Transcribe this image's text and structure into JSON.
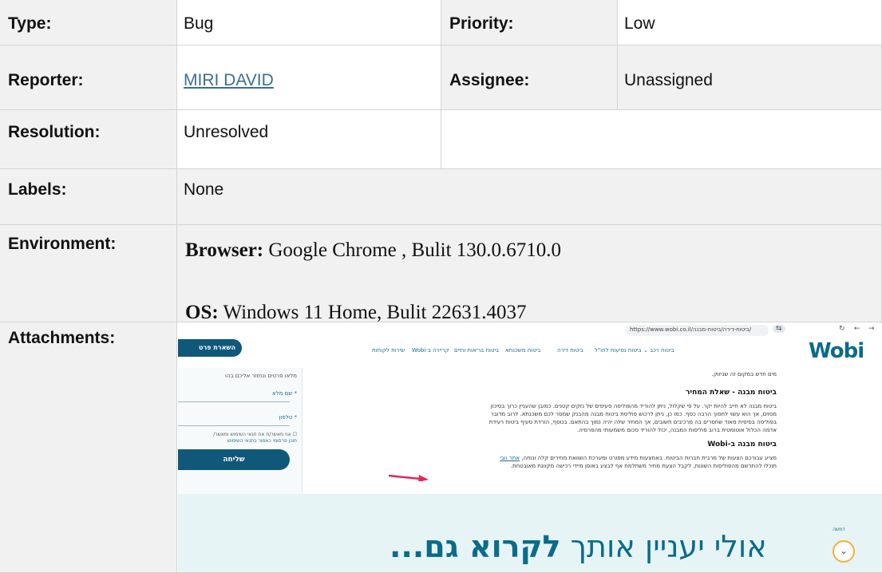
{
  "fields": {
    "type": {
      "label": "Type:",
      "value": "Bug"
    },
    "priority": {
      "label": "Priority:",
      "value": "Low"
    },
    "reporter": {
      "label": "Reporter:",
      "value": "MIRI DAVID"
    },
    "assignee": {
      "label": "Assignee:",
      "value": "Unassigned"
    },
    "resolution": {
      "label": "Resolution:",
      "value": "Unresolved"
    },
    "labels": {
      "label": "Labels:",
      "value": "None"
    },
    "environment": {
      "label": "Environment:",
      "browser_key": "Browser:",
      "browser_value": "Google Chrome , Bulit 130.0.6710.0",
      "os_key": "OS:",
      "os_value": "Windows 11 Home, Bulit 22631.4037"
    },
    "attachments": {
      "label": "Attachments:"
    }
  },
  "attachment": {
    "url": "https://www.wobi.co.il/ביטוח-דירה/ביטוח-מבנה/",
    "logo": "Wobi",
    "nav_items": [
      "ביטוח רכב ⌄",
      "ביטוח נסיעות לחו\"ל",
      "ביטוח דירה",
      "ביטוח משכנתא",
      "ביטוח בריאות וחיים",
      "קריירה ב-Wobi",
      "שירות לקוחות"
    ],
    "cta_top": "השארת פרט",
    "form_intro": "מלאו פרטים ונחזור אליכם בהו",
    "form_name": "* שם מלא",
    "form_phone": "* טלפון",
    "form_consent_1": "☐ אני מאשר/ת את תנאי השימוש ומאשר/",
    "form_consent_2": "תוכן פרסומי כאמור בתנאי השימוש",
    "send_button": "שליחה",
    "intro_line": "מים חדש במקום זה שניזוק.",
    "heading_1": "ביטוח מבנה - שאלת המחיר",
    "para_1": [
      "ביטוח מבנה לא חייב להיות יקר. על פי שקלול, ניתן להוריד מהפוליסה סעיפים של נזקים קטנים. כמובן שהעניין כרוך בסיכון",
      "מסוים, אך הוא עשוי לחסוך הרבה כסף. כמו כן, ניתן לרכוש פוליסת ביטוח מבנה מהבנק שמסר לכם משכנתא. לרוב מדובר",
      "בפוליסה בסיסית מאוד שחסרים בה מרכיבים חשובים, אך המחיר שלה יהיה נמוך בהתאם. בנוסף, הורדת סעיף ביטוח רעידת",
      "אדמה הכלול אוטומטית ברוב פוליסות המבנה, יכול להוריד סכום משמעותי מהפרמיה."
    ],
    "heading_2": "ביטוח מבנה ב-Wobi",
    "para_2_link": "אתר וובי",
    "para_2": [
      "מציע עבורכם הצעות של מרבית חברות הביטוח. באמצעות מידע מפורט ומערכת השוואת מחירים קלה ונוחה,",
      "תוכלו להתרשם מהפוליסות השונות, לקבל הצעת מחיר משתלמת אף לבצע באופן מיידי רכישה מקוונת מאובטחת."
    ],
    "banner_regular": "אולי יעניין אותך",
    "banner_bold": "לקרוא גם...",
    "share_label": "דמשה",
    "chevron": "⌄"
  }
}
